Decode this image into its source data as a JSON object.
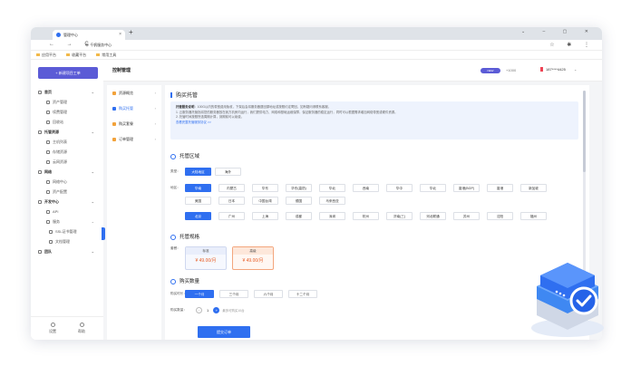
{
  "browser": {
    "tab_title": "管理中心",
    "tab_close": "×",
    "new_tab": "+",
    "window_controls": "⌄ – ▢ ✕",
    "nav_buttons": "← → C",
    "url": "⊕ 千帆服务中心",
    "addr_right": "☆ ✱ ⋮",
    "bookmarks": [
      "应用平台",
      "收藏平台",
      "常用工具"
    ]
  },
  "sidebar": {
    "create_button": "+ 新建项目工单",
    "items": [
      {
        "label": "首页",
        "type": "grp",
        "chev": "⌄"
      },
      {
        "label": "资产管理",
        "type": "sub"
      },
      {
        "label": "续费管理",
        "type": "sub"
      },
      {
        "label": "回收站",
        "type": "sub"
      },
      {
        "label": "托管资源",
        "type": "grp",
        "chev": "⌄"
      },
      {
        "label": "主机列表",
        "type": "sub"
      },
      {
        "label": "存储资源",
        "type": "sub"
      },
      {
        "label": "云网资源",
        "type": "sub"
      },
      {
        "label": "网络",
        "type": "grp",
        "chev": "⌄"
      },
      {
        "label": "网络中心",
        "type": "sub"
      },
      {
        "label": "资产配置",
        "type": "sub"
      },
      {
        "label": "开发中心",
        "type": "grp",
        "chev": "⌄"
      },
      {
        "label": "API",
        "type": "sub"
      },
      {
        "label": "服务",
        "type": "sub",
        "chev": "⌄"
      },
      {
        "label": "SSL证书管理",
        "type": "sub2"
      },
      {
        "label": "文档管理",
        "type": "sub2"
      },
      {
        "label": "团队",
        "type": "grp",
        "chev": "⌄"
      }
    ],
    "bottom": [
      {
        "label": "设置"
      },
      {
        "label": "帮助"
      }
    ]
  },
  "topbar": {
    "title": "控制管理",
    "badge": "NEW",
    "num": "+1000",
    "user": "187****4425",
    "user_chev": "⌄"
  },
  "submenu": [
    {
      "label": "资源概览",
      "active": false
    },
    {
      "label": "购买托管",
      "active": true
    },
    {
      "label": "购买套餐",
      "active": false
    },
    {
      "label": "订单管理",
      "active": false
    }
  ],
  "main": {
    "section_title": "购买托管",
    "notice": {
      "head": "托管服务说明",
      "head_rest": "：100G以内的带宽费用免收，下架后会将服务器退回原地址或按照约定寄回，如有疑问请联系客服。",
      "line1": "1. 云服务器托管指将您的服务器放在我方机房内运行，我们提供电力、网络和基础运维保障，保证服务器的稳定运行，同时可以根据需求增加网络带宽或硬件资源。",
      "line2": "2. 托管时间按照所选周期计算，到期前可以续费。",
      "link": "查看完整托管服务协议 >>"
    },
    "region": {
      "title": "托管区域",
      "type_label": "类型：",
      "types": [
        "大陆地区",
        "海外"
      ],
      "area_label": "地区：",
      "row1": [
        "华南",
        "内蒙古",
        "华东",
        "华东(高防)",
        "华北",
        "西南",
        "华中",
        "华北",
        "香港(BGP)",
        "香港",
        "新加坡"
      ],
      "row2": [
        "美国",
        "日本",
        "中国台湾",
        "德国",
        "马来西亚"
      ],
      "zone_label": "",
      "row3": [
        "北京",
        "广州",
        "上海",
        "成都",
        "深圳",
        "杭州",
        "济南(三)",
        "河北联通",
        "苏州",
        "沈阳",
        "福州"
      ]
    },
    "spec": {
      "title": "托管规格",
      "label": "套餐：",
      "cards": [
        {
          "title": "标准",
          "price": "¥ 49.00/月",
          "selected": false
        },
        {
          "title": "高级",
          "price": "¥ 49.00/月",
          "selected": true
        }
      ]
    },
    "qty": {
      "title": "购买数量",
      "period_label": "购买时长：",
      "periods": [
        "一个月",
        "三个月",
        "六个月",
        "十二个月"
      ],
      "count_label": "购买数量：",
      "minus": "−",
      "value": "1",
      "plus": "+",
      "hint": "最多可购买10台"
    },
    "submit": "提交订单"
  }
}
